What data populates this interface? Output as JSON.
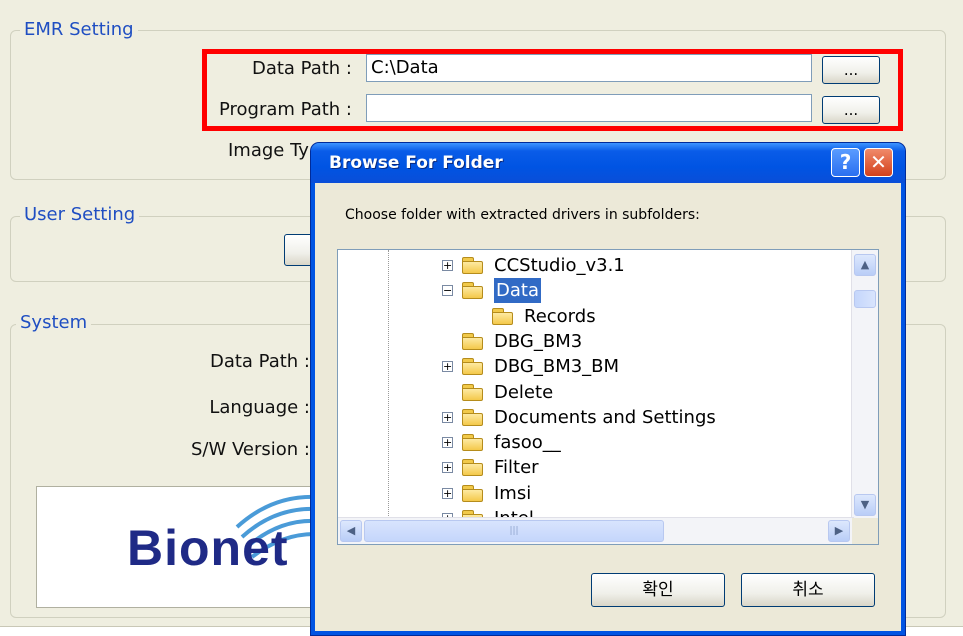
{
  "emr_setting": {
    "title": "EMR Setting",
    "data_path_label": "Data Path :",
    "data_path_value": "C:\\Data",
    "program_path_label": "Program Path :",
    "program_path_value": "",
    "browse_label": "...",
    "image_type_label": "Image Ty"
  },
  "user_setting": {
    "title": "User Setting"
  },
  "system": {
    "title": "System",
    "data_path_label": "Data Path :",
    "language_label": "Language :",
    "sw_version_label": "S/W Version :"
  },
  "logo": {
    "text": "Bionet"
  },
  "dialog": {
    "title": "Browse For Folder",
    "help_label": "?",
    "close_label": "✕",
    "instruction": "Choose folder with extracted drivers in subfolders:",
    "tree": [
      {
        "label": "CCStudio_v3.1",
        "expander": "+"
      },
      {
        "label": "Data",
        "expander": "−",
        "selected": true
      },
      {
        "label": "Records",
        "expander": ""
      },
      {
        "label": "DBG_BM3",
        "expander": ""
      },
      {
        "label": "DBG_BM3_BM",
        "expander": "+"
      },
      {
        "label": "Delete",
        "expander": ""
      },
      {
        "label": "Documents and Settings",
        "expander": "+"
      },
      {
        "label": "fasoo__",
        "expander": "+"
      },
      {
        "label": "Filter",
        "expander": "+"
      },
      {
        "label": "Imsi",
        "expander": "+"
      },
      {
        "label": "Intel",
        "expander": "+"
      }
    ],
    "ok_label": "확인",
    "cancel_label": "취소"
  }
}
